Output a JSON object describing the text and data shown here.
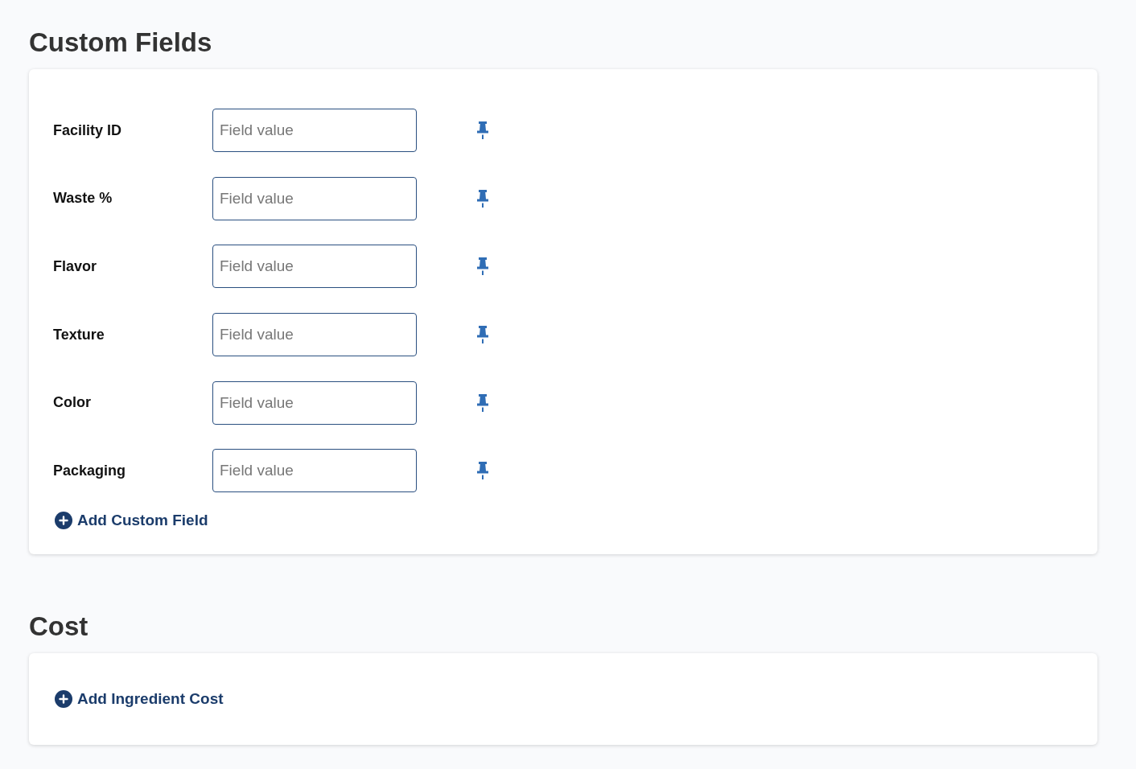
{
  "sections": [
    {
      "title": "Custom Fields",
      "fields": [
        {
          "label": "Facility ID",
          "placeholder": "Field value"
        },
        {
          "label": "Waste %",
          "placeholder": "Field value"
        },
        {
          "label": "Flavor",
          "placeholder": "Field value"
        },
        {
          "label": "Texture",
          "placeholder": "Field value"
        },
        {
          "label": "Color",
          "placeholder": "Field value"
        },
        {
          "label": "Packaging",
          "placeholder": "Field value"
        }
      ],
      "add_action": "Add Custom Field"
    },
    {
      "title": "Cost",
      "add_action": "Add Ingredient Cost"
    }
  ]
}
